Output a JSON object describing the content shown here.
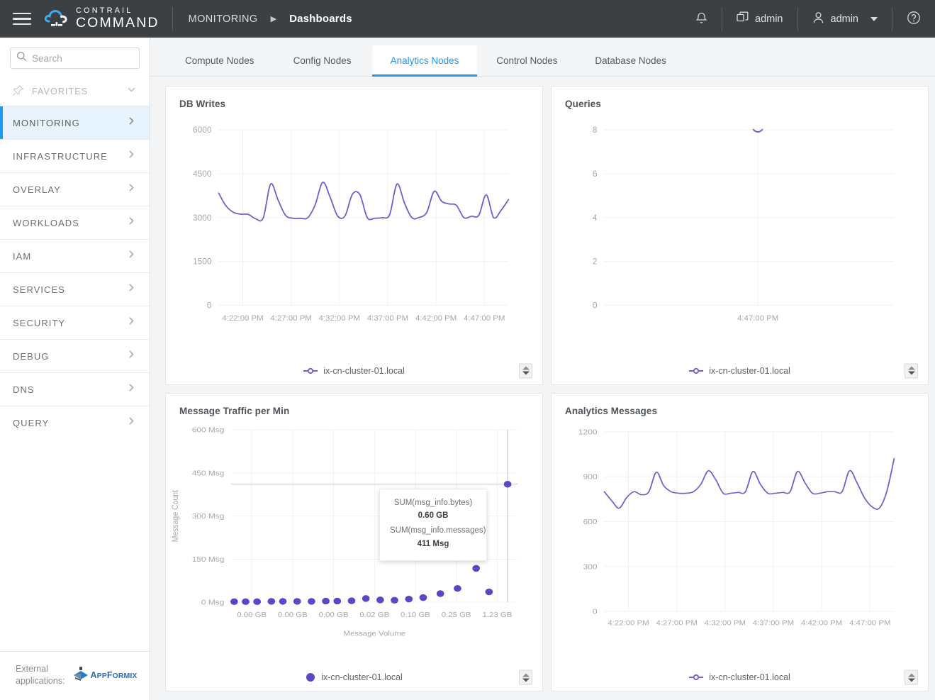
{
  "header": {
    "logo_top": "CONTRAIL",
    "logo_bottom": "COMMAND",
    "logo_icon": "cloud-icon",
    "menu_icon": "hamburger-menu-icon",
    "breadcrumb_root": "MONITORING",
    "breadcrumb_sep": "▶",
    "breadcrumb_current": "Dashboards",
    "bell_icon": "notification-bell-icon",
    "cluster_icon": "cluster-switch-icon",
    "cluster_label": "admin",
    "user_icon": "user-avatar-icon",
    "user_label": "admin",
    "help_icon": "help-circle-icon"
  },
  "sidebar": {
    "search": {
      "placeholder": "Search",
      "value": "",
      "icon": "search-icon"
    },
    "favorites": {
      "label": "FAVORITES",
      "icon": "pin-icon",
      "chevron": "chevron-down-icon"
    },
    "items": [
      {
        "label": "MONITORING",
        "active": true
      },
      {
        "label": "INFRASTRUCTURE",
        "active": false
      },
      {
        "label": "OVERLAY",
        "active": false
      },
      {
        "label": "WORKLOADS",
        "active": false
      },
      {
        "label": "IAM",
        "active": false
      },
      {
        "label": "SERVICES",
        "active": false
      },
      {
        "label": "SECURITY",
        "active": false
      },
      {
        "label": "DEBUG",
        "active": false
      },
      {
        "label": "DNS",
        "active": false
      },
      {
        "label": "QUERY",
        "active": false
      }
    ],
    "footer": {
      "label_line1": "External",
      "label_line2": "applications:",
      "app_name_big": "A",
      "app_name_rest": "PP",
      "app_name_big2": "F",
      "app_name_rest2": "ORMIX",
      "app_icon": "appformix-logo-icon"
    }
  },
  "tabs": [
    {
      "label": "Compute Nodes",
      "active": false
    },
    {
      "label": "Config Nodes",
      "active": false
    },
    {
      "label": "Analytics Nodes",
      "active": true
    },
    {
      "label": "Control Nodes",
      "active": false
    },
    {
      "label": "Database Nodes",
      "active": false
    }
  ],
  "colors": {
    "accent": "#2196f3",
    "series": "#6b5fd0",
    "scatter": "#5b47c4",
    "header_bg": "#3c4043",
    "active_nav_bg": "#e7f3fc",
    "page_bg": "#f4f5f7"
  },
  "tooltip": {
    "key1": "SUM(msg_info.bytes)",
    "val1": "0.60 GB",
    "key2": "SUM(msg_info.messages)",
    "val2": "411 Msg"
  },
  "legend_label": "ix-cn-cluster-01.local",
  "stepper_icon": "up-down-stepper-icon",
  "chart_data": [
    {
      "id": "db-writes",
      "type": "line",
      "title": "DB Writes",
      "xlabel": "",
      "ylabel": "",
      "ylim": [
        0,
        6000
      ],
      "yticks": [
        0,
        1500,
        3000,
        4500,
        6000
      ],
      "xticks": [
        "4:22:00 PM",
        "4:27:00 PM",
        "4:32:00 PM",
        "4:37:00 PM",
        "4:42:00 PM",
        "4:47:00 PM"
      ],
      "grid": true,
      "legend": [
        "ix-cn-cluster-01.local"
      ],
      "series": [
        {
          "name": "ix-cn-cluster-01.local",
          "values": [
            3840,
            3400,
            3180,
            3120,
            3110,
            2960,
            2990,
            4150,
            3600,
            3080,
            2980,
            2980,
            3000,
            3450,
            4210,
            3700,
            3060,
            3060,
            3800,
            3790,
            3000,
            2980,
            3000,
            3100,
            4150,
            3500,
            3000,
            3010,
            3180,
            3900,
            3560,
            3470,
            3420,
            3000,
            3050,
            3080,
            3780,
            3000,
            3250,
            3620
          ]
        }
      ]
    },
    {
      "id": "queries",
      "type": "line",
      "title": "Queries",
      "xlabel": "",
      "ylabel": "",
      "ylim": [
        0,
        8
      ],
      "yticks": [
        0,
        2,
        4,
        6,
        8
      ],
      "xticks": [
        "4:47:00 PM"
      ],
      "grid": true,
      "legend": [
        "ix-cn-cluster-01.local"
      ],
      "series": [
        {
          "name": "ix-cn-cluster-01.local",
          "values": [
            8,
            8,
            8
          ]
        }
      ],
      "note": "single data point near 8 at 4:47:00 PM"
    },
    {
      "id": "message-traffic-per-min",
      "type": "scatter",
      "title": "Message Traffic per Min",
      "xlabel": "Message Volume",
      "ylabel": "Message Count",
      "ylim": [
        0,
        600
      ],
      "yticks": [
        "0 Msg",
        "150 Msg",
        "300 Msg",
        "450 Msg",
        "600 Msg"
      ],
      "xticks": [
        "0.00 GB",
        "0.00 GB",
        "0.00 GB",
        "0.02 GB",
        "0.10 GB",
        "0.25 GB",
        "1.23 GB"
      ],
      "grid": true,
      "legend": [
        "ix-cn-cluster-01.local"
      ],
      "points": [
        {
          "x": 0.01,
          "y": 2
        },
        {
          "x": 0.05,
          "y": 2
        },
        {
          "x": 0.09,
          "y": 2
        },
        {
          "x": 0.14,
          "y": 3
        },
        {
          "x": 0.18,
          "y": 3
        },
        {
          "x": 0.23,
          "y": 3
        },
        {
          "x": 0.28,
          "y": 3
        },
        {
          "x": 0.33,
          "y": 4
        },
        {
          "x": 0.37,
          "y": 4
        },
        {
          "x": 0.42,
          "y": 5
        },
        {
          "x": 0.47,
          "y": 13
        },
        {
          "x": 0.52,
          "y": 8
        },
        {
          "x": 0.57,
          "y": 7
        },
        {
          "x": 0.62,
          "y": 11
        },
        {
          "x": 0.67,
          "y": 16
        },
        {
          "x": 0.73,
          "y": 30
        },
        {
          "x": 0.79,
          "y": 48
        },
        {
          "x": 0.855,
          "y": 118
        },
        {
          "x": 0.9,
          "y": 36
        },
        {
          "x": 0.965,
          "y": 411
        }
      ],
      "highlight_point": {
        "x": 0.965,
        "y": 411,
        "label": "411 Msg"
      }
    },
    {
      "id": "analytics-messages",
      "type": "line",
      "title": "Analytics Messages",
      "xlabel": "",
      "ylabel": "",
      "ylim": [
        0,
        1200
      ],
      "yticks": [
        0,
        300,
        600,
        900,
        1200
      ],
      "xticks": [
        "4:22:00 PM",
        "4:27:00 PM",
        "4:32:00 PM",
        "4:37:00 PM",
        "4:42:00 PM",
        "4:47:00 PM"
      ],
      "grid": true,
      "legend": [
        "ix-cn-cluster-01.local"
      ],
      "series": [
        {
          "name": "ix-cn-cluster-01.local",
          "values": [
            800,
            740,
            690,
            760,
            800,
            780,
            800,
            930,
            840,
            800,
            790,
            790,
            800,
            850,
            940,
            880,
            790,
            790,
            795,
            800,
            935,
            850,
            790,
            790,
            795,
            800,
            935,
            860,
            790,
            790,
            800,
            800,
            800,
            940,
            860,
            760,
            700,
            690,
            800,
            1020
          ]
        }
      ]
    }
  ]
}
